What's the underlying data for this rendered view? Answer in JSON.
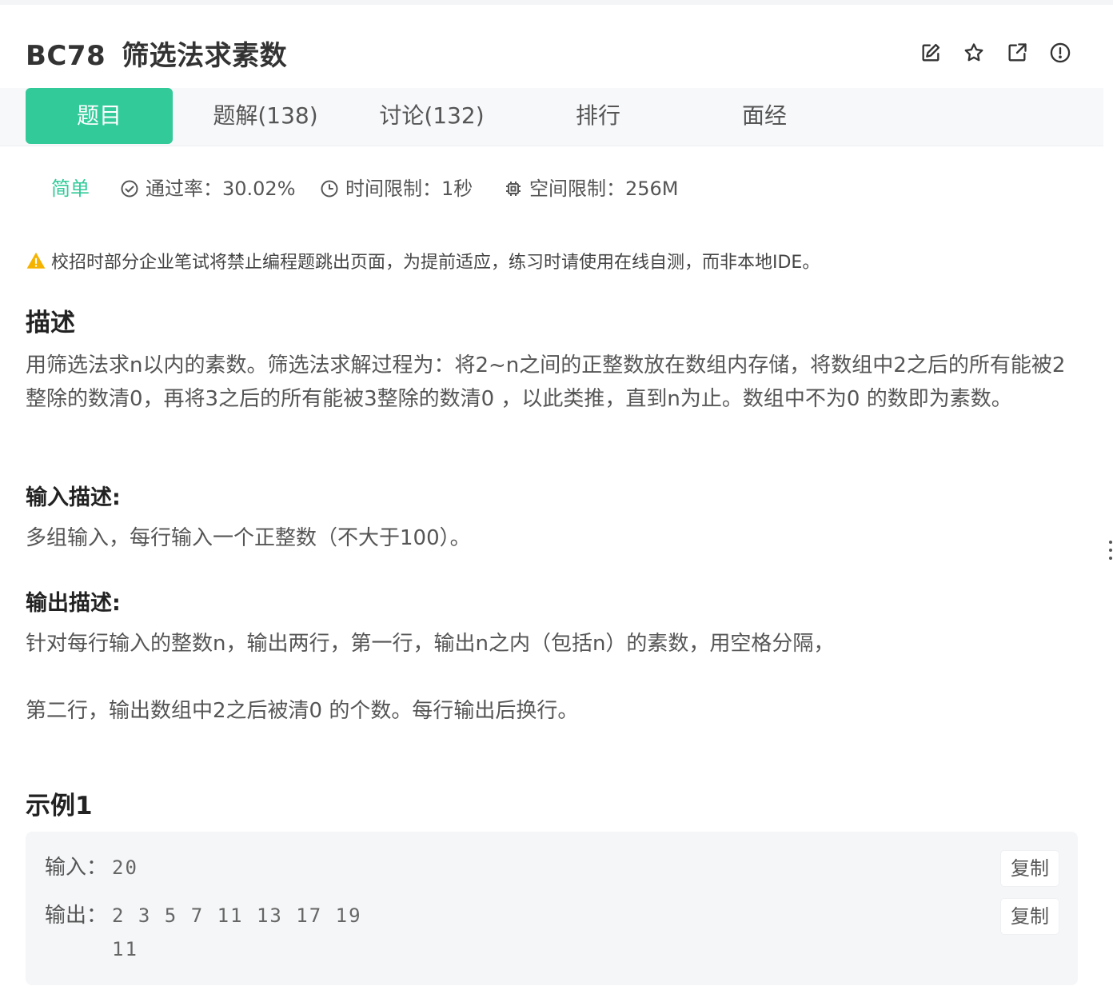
{
  "header": {
    "code": "BC78",
    "title": "筛选法求素数",
    "icons": [
      "edit-icon",
      "star-icon",
      "external-link-icon",
      "report-icon"
    ]
  },
  "tabs": [
    {
      "label": "题目",
      "active": true
    },
    {
      "label": "题解(138)",
      "active": false
    },
    {
      "label": "讨论(132)",
      "active": false
    },
    {
      "label": "排行",
      "active": false
    },
    {
      "label": "面经",
      "active": false
    }
  ],
  "meta": {
    "level": "简单",
    "pass_rate": "通过率：30.02%",
    "time_limit": "时间限制：1秒",
    "memory_limit": "空间限制：256M"
  },
  "warning": "校招时部分企业笔试将禁止编程题跳出页面，为提前适应，练习时请使用在线自测，而非本地IDE。",
  "description": {
    "heading": "描述",
    "text": "用筛选法求n以内的素数。筛选法求解过程为：将2~n之间的正整数放在数组内存储，将数组中2之后的所有能被2整除的数清0，再将3之后的所有能被3整除的数清0 ，以此类推，直到n为止。数组中不为0 的数即为素数。"
  },
  "input_desc": {
    "heading": "输入描述:",
    "text": "多组输入，每行输入一个正整数（不大于100）。"
  },
  "output_desc": {
    "heading": "输出描述:",
    "line1": "针对每行输入的整数n，输出两行，第一行，输出n之内（包括n）的素数，用空格分隔，",
    "line2": "第二行，输出数组中2之后被清0 的个数。每行输出后换行。"
  },
  "example": {
    "heading": "示例1",
    "input_label": "输入：",
    "input_value": "20",
    "output_label": "输出：",
    "output_line1": "2 3 5 7 11 13 17 19",
    "output_line2": "11",
    "copy_label": "复制"
  },
  "colors": {
    "accent": "#32ca99",
    "warning": "#f5b300"
  }
}
